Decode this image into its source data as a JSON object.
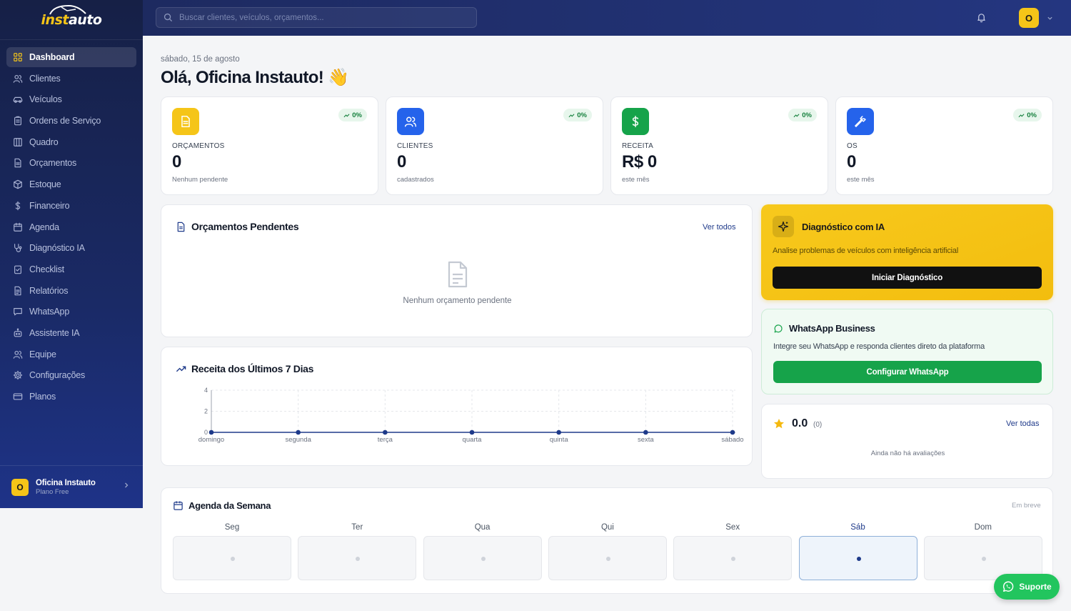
{
  "brand": {
    "logo_prefix": "inst",
    "logo_suffix": "auto"
  },
  "search": {
    "placeholder": "Buscar clientes, veículos, orçamentos..."
  },
  "topbar": {
    "avatar_letter": "O"
  },
  "sidebar": {
    "items": [
      {
        "label": "Dashboard",
        "icon": "grid-icon",
        "active": true
      },
      {
        "label": "Clientes",
        "icon": "users-icon"
      },
      {
        "label": "Veículos",
        "icon": "car-icon"
      },
      {
        "label": "Ordens de Serviço",
        "icon": "clipboard-icon"
      },
      {
        "label": "Quadro",
        "icon": "kanban-icon"
      },
      {
        "label": "Orçamentos",
        "icon": "file-icon"
      },
      {
        "label": "Estoque",
        "icon": "box-icon"
      },
      {
        "label": "Financeiro",
        "icon": "dollar-icon"
      },
      {
        "label": "Agenda",
        "icon": "calendar-icon"
      },
      {
        "label": "Diagnóstico IA",
        "icon": "stethoscope-icon"
      },
      {
        "label": "Checklist",
        "icon": "checklist-icon"
      },
      {
        "label": "Relatórios",
        "icon": "report-icon"
      },
      {
        "label": "WhatsApp",
        "icon": "chat-icon"
      },
      {
        "label": "Assistente IA",
        "icon": "bot-icon"
      },
      {
        "label": "Equipe",
        "icon": "team-icon"
      },
      {
        "label": "Configurações",
        "icon": "gear-icon"
      },
      {
        "label": "Planos",
        "icon": "card-icon"
      }
    ],
    "user": {
      "avatar_letter": "O",
      "name": "Oficina Instauto",
      "plan": "Plano Free"
    }
  },
  "header": {
    "date": "sábado, 15 de agosto",
    "greeting": "Olá, Oficina Instauto! 👋"
  },
  "stats": [
    {
      "label": "ORÇAMENTOS",
      "value": "0",
      "sub": "Nenhum pendente",
      "badge": "0%",
      "color": "#f5c518",
      "icon": "file-icon"
    },
    {
      "label": "CLIENTES",
      "value": "0",
      "sub": "cadastrados",
      "badge": "0%",
      "color": "#2563eb",
      "icon": "users-icon"
    },
    {
      "label": "RECEITA",
      "value": "R$ 0",
      "sub": "este mês",
      "badge": "0%",
      "color": "#16a34a",
      "icon": "dollar-icon"
    },
    {
      "label": "OS",
      "value": "0",
      "sub": "este mês",
      "badge": "0%",
      "color": "#2563eb",
      "icon": "wrench-icon"
    }
  ],
  "pending": {
    "title": "Orçamentos Pendentes",
    "link": "Ver todos",
    "empty": "Nenhum orçamento pendente"
  },
  "revenue": {
    "title": "Receita dos Últimos 7 Dias"
  },
  "ai": {
    "title": "Diagnóstico com IA",
    "desc": "Analise problemas de veículos com inteligência artificial",
    "button": "Iniciar Diagnóstico"
  },
  "whatsapp": {
    "title": "WhatsApp Business",
    "desc": "Integre seu WhatsApp e responda clientes direto da plataforma",
    "button": "Configurar WhatsApp"
  },
  "reviews": {
    "score": "0.0",
    "count": "(0)",
    "link": "Ver todas",
    "empty": "Ainda não há avaliações"
  },
  "agenda": {
    "title": "Agenda da Semana",
    "badge": "Em breve",
    "days": [
      "Seg",
      "Ter",
      "Qua",
      "Qui",
      "Sex",
      "Sáb",
      "Dom"
    ],
    "today_index": 5
  },
  "support": {
    "label": "Suporte"
  },
  "chart_data": {
    "type": "line",
    "title": "Receita dos Últimos 7 Dias",
    "categories": [
      "domingo",
      "segunda",
      "terça",
      "quarta",
      "quinta",
      "sexta",
      "sábado"
    ],
    "values": [
      0,
      0,
      0,
      0,
      0,
      0,
      0
    ],
    "ylim": [
      0,
      4
    ],
    "yticks": [
      "0",
      "2",
      "4"
    ],
    "grid": true,
    "color": "#1e3a8a"
  }
}
